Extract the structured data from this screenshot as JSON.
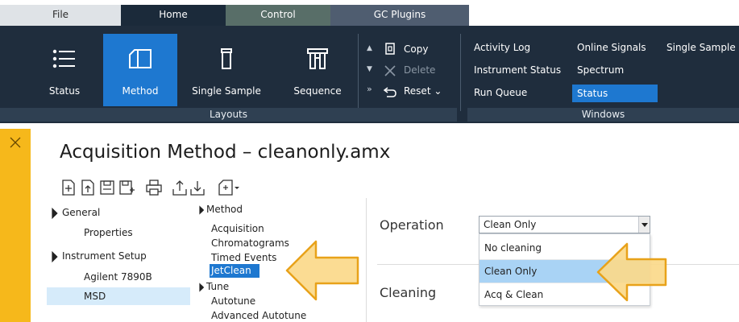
{
  "tabs": [
    "File",
    "Home",
    "Control",
    "GC Plugins"
  ],
  "layouts": {
    "status_label": "Status",
    "method_label": "Method",
    "single_sample_label": "Single Sample",
    "sequence_label": "Sequence",
    "copy_label": "Copy",
    "delete_label": "Delete",
    "reset_label": "Reset",
    "group_label": "Layouts"
  },
  "windows": {
    "activity_log": "Activity Log",
    "instrument_status": "Instrument Status",
    "run_queue": "Run Queue",
    "online_signals": "Online Signals",
    "spectrum": "Spectrum",
    "status": "Status",
    "single_sample": "Single Sample",
    "group_label": "Windows"
  },
  "page": {
    "title": "Acquisition Method – cleanonly.amx"
  },
  "tree_left": {
    "general": "General",
    "properties": "Properties",
    "instrument_setup": "Instrument Setup",
    "agilent": "Agilent 7890B",
    "msd": "MSD"
  },
  "tree_method": {
    "method": "Method",
    "acquisition": "Acquisition",
    "chromatograms": "Chromatograms",
    "timed_events": "Timed Events",
    "jetclean": "JetClean",
    "tune": "Tune",
    "autotune": "Autotune",
    "advanced_autotune": "Advanced Autotune"
  },
  "form": {
    "operation_label": "Operation",
    "operation_value": "Clean Only",
    "cleaning_label": "Cleaning",
    "options": [
      "No cleaning",
      "Clean Only",
      "Acq & Clean"
    ]
  },
  "colors": {
    "ribbon": "#1f2d3d",
    "accent_blue": "#1e78d0",
    "side_strip": "#f6b81b",
    "arrow_fill": "#fbd98a",
    "arrow_stroke": "#e8a21a",
    "selected_option": "#a9d3f5"
  }
}
